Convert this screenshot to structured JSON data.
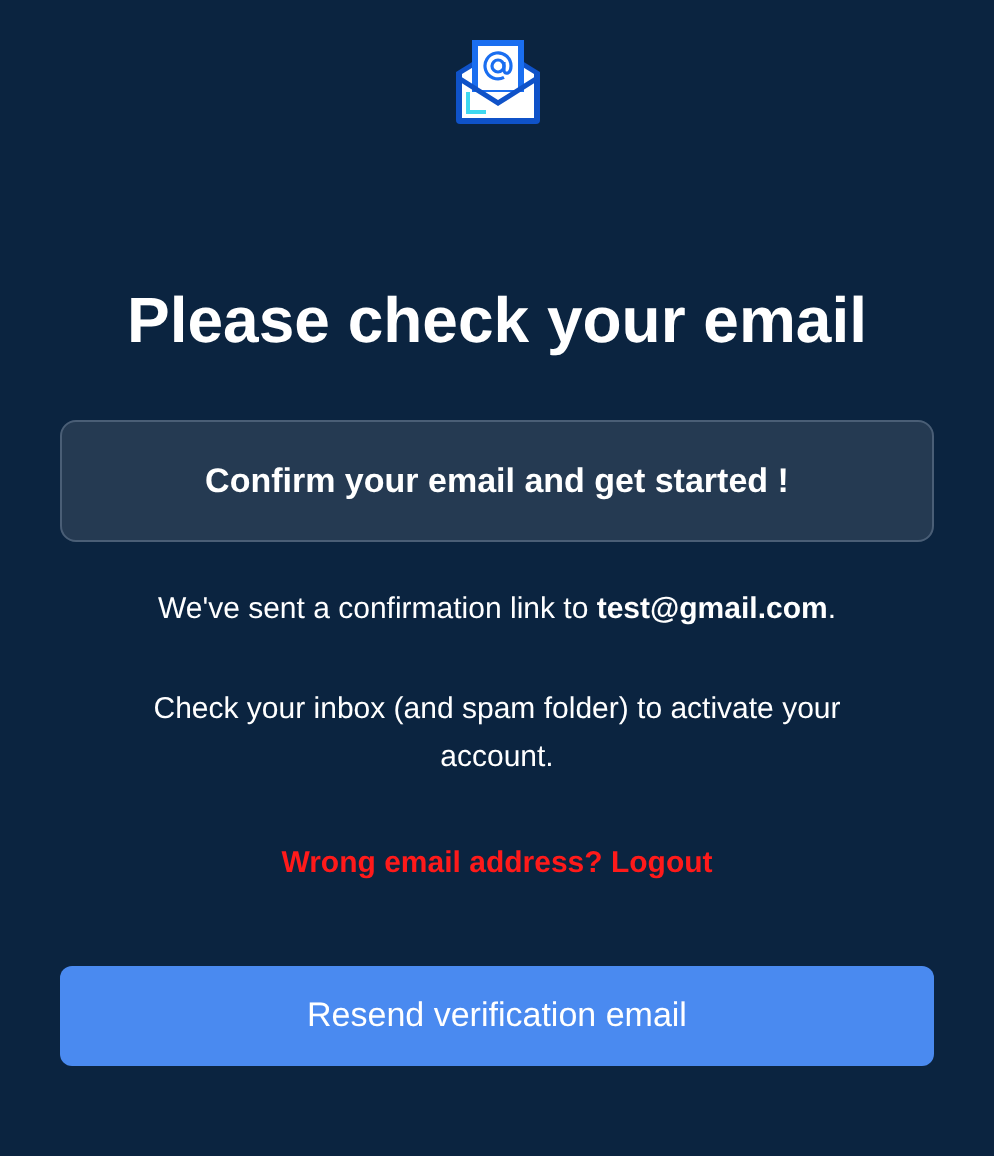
{
  "title": "Please check your email",
  "banner": "Confirm your email and get started !",
  "sent_message": "We've sent a confirmation link to **test@gmail.com**.",
  "instructions": "Check your inbox (and spam folder) to activate your account.",
  "logout_link": "Wrong email address? Logout",
  "resend_button": "Resend verification email"
}
